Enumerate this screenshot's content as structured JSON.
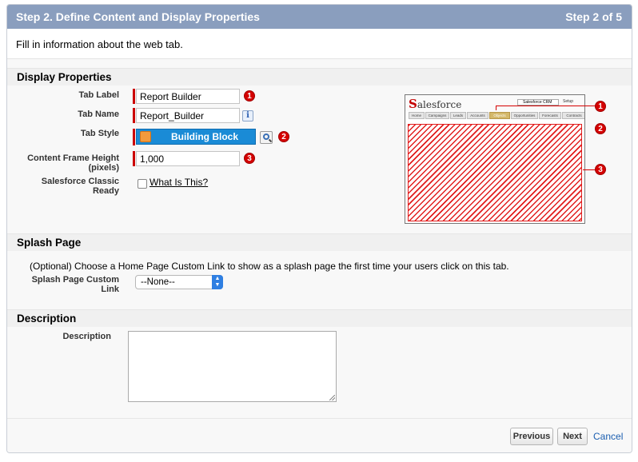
{
  "header": {
    "title": "Step 2. Define Content and Display Properties",
    "step": "Step 2 of 5"
  },
  "intro": "Fill in information about the web tab.",
  "display": {
    "heading": "Display Properties",
    "tab_label": {
      "label": "Tab Label",
      "value": "Report Builder",
      "marker": "1"
    },
    "tab_name": {
      "label": "Tab Name",
      "value": "Report_Builder",
      "info": "i"
    },
    "tab_style": {
      "label": "Tab Style",
      "value": "Building Block",
      "marker": "2"
    },
    "frame_height": {
      "label_line1": "Content Frame Height",
      "label_line2": "(pixels)",
      "value": "1,000",
      "marker": "3"
    },
    "classic": {
      "label_line1": "Salesforce Classic",
      "label_line2": "Ready",
      "checked": false,
      "link": "What Is This?"
    }
  },
  "preview": {
    "logo": "alesforce",
    "logo_initial": "S",
    "app_selector": "Salesforce CRM",
    "setup": "Setup",
    "tabs": [
      "Home",
      "Campaigns",
      "Leads",
      "Accounts",
      "Objects",
      "Opportunities",
      "Forecasts",
      "Contracts"
    ],
    "markers": [
      "1",
      "2",
      "3"
    ],
    "accent_color": "#d50000"
  },
  "splash": {
    "heading": "Splash Page",
    "text": "(Optional) Choose a Home Page Custom Link to show as a splash page the first time your users click on this tab.",
    "label_line1": "Splash Page Custom",
    "label_line2": "Link",
    "selected": "--None--"
  },
  "description": {
    "heading": "Description",
    "label": "Description",
    "value": ""
  },
  "footer": {
    "previous": "Previous",
    "next": "Next",
    "cancel": "Cancel"
  }
}
